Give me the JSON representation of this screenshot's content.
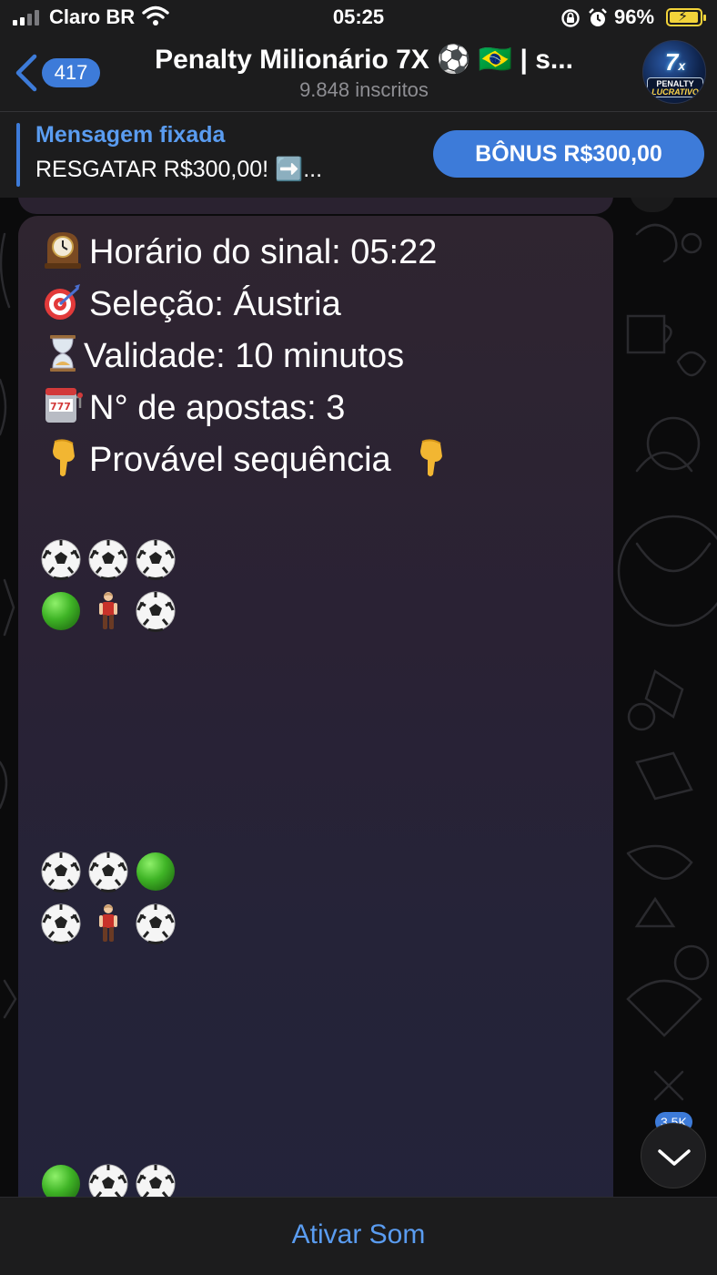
{
  "status_bar": {
    "carrier": "Claro BR",
    "time": "05:25",
    "battery": "96%",
    "battery_level": 0.96
  },
  "header": {
    "back_count": "417",
    "title": "Penalty Milionário 7X ⚽️ 🇧🇷 | s...",
    "subtitle": "9.848 inscritos",
    "avatar": {
      "big": "7",
      "small": "x",
      "line1": "PENALTY",
      "line2": "LUCRATIVO"
    }
  },
  "pinned": {
    "title": "Mensagem fixada",
    "text": "RESGATAR R$300,00! ➡️...",
    "button": "BÔNUS R$300,00"
  },
  "message": {
    "lines": [
      {
        "icon": "mantelpiece-clock-icon",
        "text": "Horário do sinal: 05:22"
      },
      {
        "icon": "dart-target-icon",
        "text": "Seleção: Áustria"
      },
      {
        "icon": "hourglass-icon",
        "text": "Validade: 10 minutos"
      },
      {
        "icon": "slot-machine-icon",
        "text": "N° de apostas: 3"
      },
      {
        "icon": "pointing-down-icon",
        "text": "Provável sequência",
        "icon_after": "pointing-down-icon"
      }
    ],
    "grids": [
      {
        "rows": [
          [
            "ball",
            "ball",
            "ball"
          ],
          [
            "green",
            "keeper",
            "ball"
          ]
        ]
      },
      {
        "rows": [
          [
            "ball",
            "ball",
            "green"
          ],
          [
            "ball",
            "keeper",
            "ball"
          ]
        ]
      },
      {
        "rows": [
          [
            "green",
            "ball",
            "ball"
          ]
        ]
      }
    ]
  },
  "scroll": {
    "badge": "3,5K"
  },
  "bottom": {
    "activate_sound": "Ativar Som"
  },
  "colors": {
    "accent": "#3d7bd9",
    "link": "#5a9cf0",
    "bar": "#1c1c1d"
  }
}
